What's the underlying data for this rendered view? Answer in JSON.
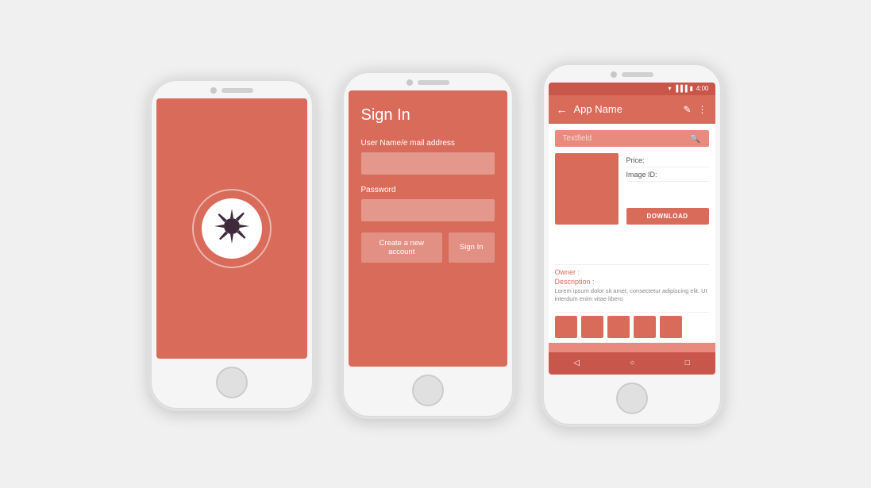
{
  "phone1": {
    "label": "splash-phone"
  },
  "phone2": {
    "label": "signin-phone",
    "screen": {
      "title": "Sign In",
      "username_label": "User Name/e mail address",
      "password_label": "Password",
      "btn_create": "Create a new account",
      "btn_signin": "Sign In"
    }
  },
  "phone3": {
    "label": "detail-phone",
    "status_bar": {
      "time": "4:00"
    },
    "header": {
      "title": "App Name"
    },
    "search": {
      "placeholder": "Textfield"
    },
    "product": {
      "price_label": "Price:",
      "image_id_label": "Image ID:",
      "download_btn": "DOWNLOAD"
    },
    "meta": {
      "owner_label": "Owner :",
      "description_label": "Description :",
      "description_text": "Lorem ipsum dolor sit amet, consectetur adipiscing elit. Ut interdum enim vitae libero"
    }
  }
}
